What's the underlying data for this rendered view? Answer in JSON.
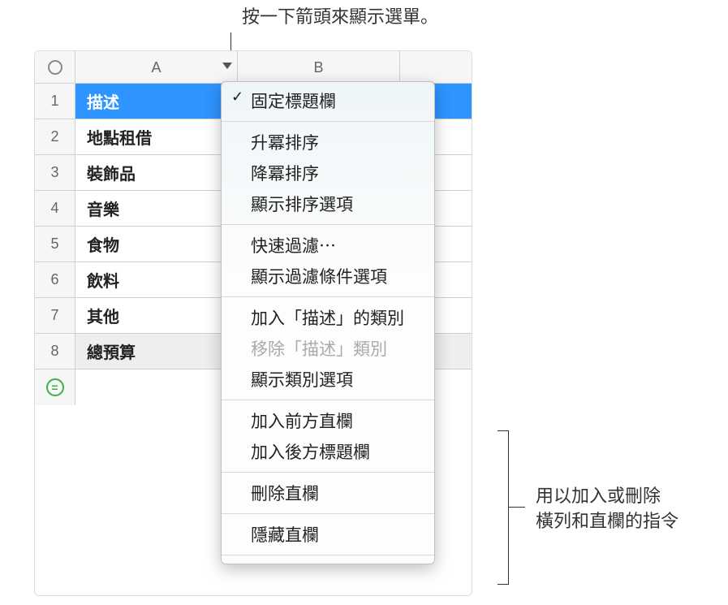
{
  "annotations": {
    "top": "按一下箭頭來顯示選單。",
    "right_line1": "用以加入或刪除",
    "right_line2": "橫列和直欄的指令"
  },
  "columns": {
    "a": "A",
    "b": "B"
  },
  "rows": {
    "r1": "1",
    "r2": "2",
    "r3": "3",
    "r4": "4",
    "r5": "5",
    "r6": "6",
    "r7": "7",
    "r8": "8"
  },
  "cells": {
    "c1": "描述",
    "c2": "地點租借",
    "c3": "裝飾品",
    "c4": "音樂",
    "c5": "食物",
    "c6": "飲料",
    "c7": "其他",
    "c8": "總預算"
  },
  "menu": {
    "freeze": "固定標題欄",
    "sort_asc": "升冪排序",
    "sort_desc": "降冪排序",
    "sort_opts": "顯示排序選項",
    "quick_filter": "快速過濾⋯",
    "filter_opts": "顯示過濾條件選項",
    "add_cat": "加入「描述」的類別",
    "remove_cat": "移除「描述」類別",
    "show_cat": "顯示類別選項",
    "add_before": "加入前方直欄",
    "add_after": "加入後方標題欄",
    "delete_col": "刪除直欄",
    "hide_col": "隱藏直欄"
  },
  "icons": {
    "equals": "="
  }
}
